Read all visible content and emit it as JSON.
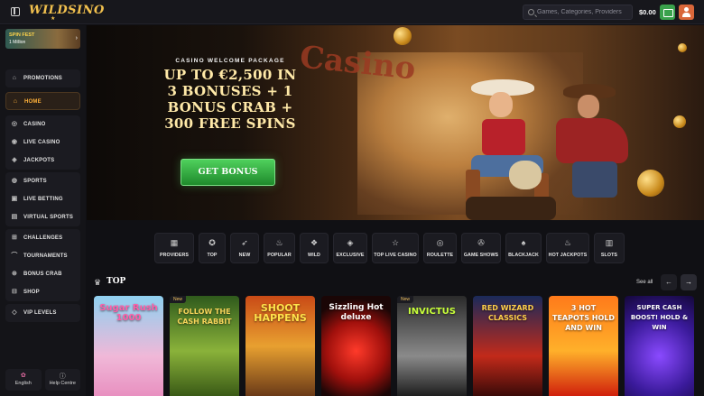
{
  "header": {
    "logo_text": "WILDSINO",
    "search_placeholder": "Games, Categories, Providers",
    "balance": "$0.00"
  },
  "sidebar": {
    "promo": {
      "title": "SPIN FEST",
      "subtitle": "1 Million"
    },
    "groups": [
      {
        "items": [
          {
            "label": "PROMOTIONS",
            "icon": "gift-icon"
          }
        ]
      },
      {
        "items": [
          {
            "label": "HOME",
            "icon": "home-icon",
            "active": true
          }
        ]
      },
      {
        "items": [
          {
            "label": "CASINO",
            "icon": "casino-chip-icon"
          },
          {
            "label": "LIVE CASINO",
            "icon": "live-icon"
          },
          {
            "label": "JACKPOTS",
            "icon": "jackpot-icon"
          }
        ]
      },
      {
        "items": [
          {
            "label": "SPORTS",
            "icon": "ball-icon"
          },
          {
            "label": "LIVE BETTING",
            "icon": "live-betting-icon"
          },
          {
            "label": "VIRTUAL SPORTS",
            "icon": "virtual-icon"
          }
        ]
      },
      {
        "items": [
          {
            "label": "CHALLENGES",
            "icon": "challenge-icon"
          },
          {
            "label": "TOURNAMENTS",
            "icon": "trophy-icon"
          },
          {
            "label": "BONUS CRAB",
            "icon": "crab-icon"
          },
          {
            "label": "SHOP",
            "icon": "shop-icon"
          }
        ]
      },
      {
        "items": [
          {
            "label": "VIP LEVELS",
            "icon": "diamond-icon"
          }
        ]
      }
    ],
    "language": "English",
    "help": "Help Centre"
  },
  "banner": {
    "kicker": "CASINO WELCOME PACKAGE",
    "headline": "UP TO €2,500 IN 3 BONUSES + 1 BONUS CRAB + 300 FREE SPINS",
    "sign_text": "Casino",
    "cta": "GET BONUS"
  },
  "categories": [
    {
      "label": "PROVIDERS",
      "icon": "grid-icon",
      "w": 44
    },
    {
      "label": "TOP",
      "icon": "medal-icon",
      "w": 30
    },
    {
      "label": "NEW",
      "icon": "rocket-icon",
      "w": 32
    },
    {
      "label": "POPULAR",
      "icon": "flame-icon",
      "w": 35
    },
    {
      "label": "WILD",
      "icon": "drop-icon",
      "w": 32
    },
    {
      "label": "EXCLUSIVE",
      "icon": "gem-icon",
      "w": 38
    },
    {
      "label": "TOP LIVE CASINO",
      "icon": "star-icon",
      "w": 52
    },
    {
      "label": "ROULETTE",
      "icon": "roulette-icon",
      "w": 37
    },
    {
      "label": "GAME SHOWS",
      "icon": "wheel-icon",
      "w": 44
    },
    {
      "label": "BLACKJACK",
      "icon": "spade-icon",
      "w": 40
    },
    {
      "label": "HOT JACKPOTS",
      "icon": "flame-jackpot-icon",
      "w": 48
    },
    {
      "label": "SLOTS",
      "icon": "slot-icon",
      "w": 34
    }
  ],
  "top_section": {
    "title": "TOP",
    "see_all": "See all",
    "prev": "←",
    "next": "→",
    "games": [
      {
        "title": "Sugar Rush 1000",
        "badge": "",
        "bg": "linear-gradient(180deg,#8fd0f0,#f0b8d8 60%,#e890c0)",
        "color": "#ff5fa8",
        "size": 10
      },
      {
        "title": "FOLLOW THE CASH RABBIT",
        "badge": "New",
        "bg": "linear-gradient(180deg,#2f5a1c,#8ab23a 55%,#3a5a16)",
        "color": "#f6d45a",
        "size": 8
      },
      {
        "title": "SHOOT HAPPENS",
        "badge": "",
        "bg": "linear-gradient(180deg,#c94a16,#e8a030 50%,#6a3a18)",
        "color": "#ffe24a",
        "size": 11
      },
      {
        "title": "Sizzling Hot deluxe",
        "badge": "",
        "bg": "radial-gradient(circle at 50% 55%,#ff3a2a,#a0100c 45%,#1a0606 80%)",
        "color": "#fff",
        "size": 9
      },
      {
        "title": "INVICTUS",
        "badge": "New",
        "bg": "linear-gradient(180deg,#2a2a2a,#8a8a8a 60%,#1e1e1e)",
        "color": "#c8ff3a",
        "size": 10
      },
      {
        "title": "RED WIZARD CLASSICS",
        "badge": "",
        "bg": "linear-gradient(180deg,#1a2a5a,#c22a1a 60%,#3a0a08)",
        "color": "#ffd04a",
        "size": 8
      },
      {
        "title": "3 HOT TEAPOTS HOLD AND WIN",
        "badge": "",
        "bg": "linear-gradient(180deg,#ff7a1a,#ffb02a 55%,#d0200c)",
        "color": "#fff",
        "size": 8
      },
      {
        "title": "SUPER CASH BOOST! HOLD & WIN",
        "badge": "",
        "bg": "radial-gradient(circle at 50% 60%,#8a4aff,#3a1a9a 55%,#14083a)",
        "color": "#fff",
        "size": 7
      }
    ]
  },
  "colors": {
    "accent": "#ffb13a",
    "cta_green": "#3aa14c",
    "user_orange": "#d9673a"
  }
}
